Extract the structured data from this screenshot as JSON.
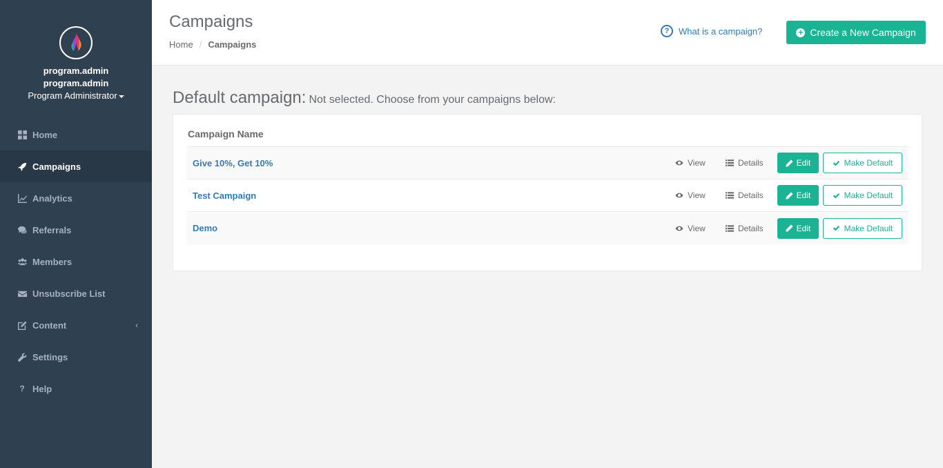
{
  "sidebar": {
    "user_line1": "program.admin",
    "user_line2": "program.admin",
    "role": "Program Administrator",
    "items": [
      {
        "label": "Home",
        "icon": "th-large-icon"
      },
      {
        "label": "Campaigns",
        "icon": "rocket-icon",
        "active": true
      },
      {
        "label": "Analytics",
        "icon": "line-chart-icon"
      },
      {
        "label": "Referrals",
        "icon": "comments-icon"
      },
      {
        "label": "Members",
        "icon": "users-icon"
      },
      {
        "label": "Unsubscribe List",
        "icon": "envelope-icon"
      },
      {
        "label": "Content",
        "icon": "edit-icon",
        "arrow": "‹"
      },
      {
        "label": "Settings",
        "icon": "wrench-icon"
      },
      {
        "label": "Help",
        "icon": "question-icon"
      }
    ]
  },
  "header": {
    "title": "Campaigns",
    "breadcrumb": {
      "home": "Home",
      "separator": "/",
      "current": "Campaigns"
    },
    "help_link": "What is a campaign?",
    "create_button": "Create a New Campaign"
  },
  "main": {
    "default_title": "Default campaign:",
    "default_sub": "Not selected. Choose from your campaigns below:",
    "table": {
      "column": "Campaign Name",
      "rows": [
        {
          "name": "Give 10%, Get 10%"
        },
        {
          "name": "Test Campaign"
        },
        {
          "name": "Demo"
        }
      ],
      "action_view": "View",
      "action_details": "Details",
      "action_edit": "Edit",
      "action_make_default": "Make Default"
    }
  },
  "colors": {
    "sidebar_bg": "#2f4050",
    "accent": "#1ab394",
    "link": "#337ab7"
  }
}
